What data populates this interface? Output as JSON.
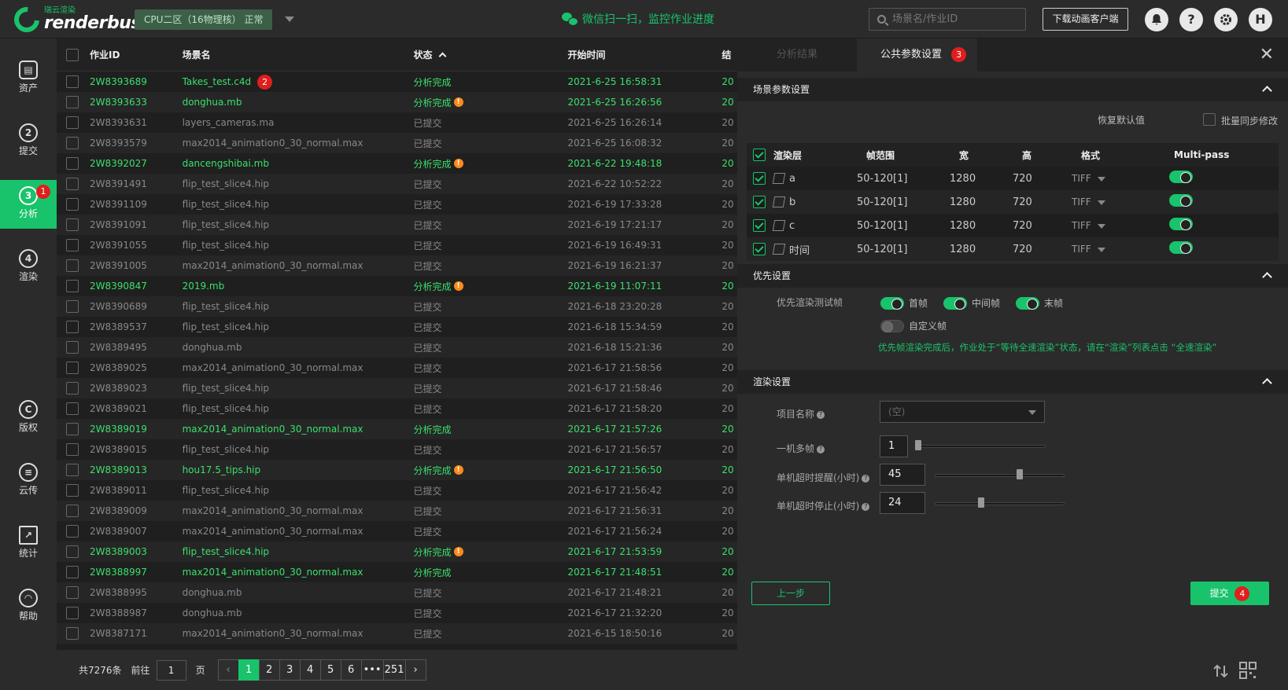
{
  "header": {
    "logo_cn": "瑞云渲染",
    "logo_en": "renderbus",
    "cpu_select": "CPU二区（16物理核）  正常",
    "wechat_text": "微信扫一扫，监控作业进度",
    "search_placeholder": "场景名/作业ID",
    "download_button": "下载动画客户端",
    "help_icon": "?",
    "avatar": "H"
  },
  "sidebar": {
    "items": [
      {
        "label": "资产",
        "icon": "asset-icon",
        "glyph": "▤"
      },
      {
        "label": "提交",
        "icon": "submit-icon",
        "glyph": "2"
      },
      {
        "label": "分析",
        "icon": "analyze-icon",
        "glyph": "3",
        "badge": "1",
        "active": true
      },
      {
        "label": "渲染",
        "icon": "render-icon",
        "glyph": "4"
      },
      {
        "label": "版权",
        "icon": "copyright-icon",
        "glyph": "C"
      },
      {
        "label": "云传",
        "icon": "cloud-transfer-icon",
        "glyph": "≡"
      },
      {
        "label": "统计",
        "icon": "stats-icon",
        "glyph": "↗"
      },
      {
        "label": "帮助",
        "icon": "help-icon",
        "glyph": "◠"
      }
    ]
  },
  "table": {
    "columns": [
      "作业ID",
      "场景名",
      "状态",
      "开始时间",
      "结"
    ],
    "rows": [
      {
        "id": "2W8393689",
        "name": "Takes_test.c4d",
        "status": "分析完成",
        "time": "2021-6-25 16:58:31",
        "more": "20",
        "green": true,
        "warn": false,
        "badge": "2"
      },
      {
        "id": "2W8393633",
        "name": "donghua.mb",
        "status": "分析完成",
        "time": "2021-6-25 16:26:56",
        "more": "20",
        "green": true,
        "warn": true
      },
      {
        "id": "2W8393631",
        "name": "layers_cameras.ma",
        "status": "已提交",
        "time": "2021-6-25 16:26:14",
        "more": "20",
        "green": false
      },
      {
        "id": "2W8393579",
        "name": "max2014_animation0_30_normal.max",
        "status": "已提交",
        "time": "2021-6-25 16:08:32",
        "more": "20",
        "green": false
      },
      {
        "id": "2W8392027",
        "name": "dancengshibai.mb",
        "status": "分析完成",
        "time": "2021-6-22 19:48:18",
        "more": "20",
        "green": true,
        "warn": true
      },
      {
        "id": "2W8391491",
        "name": "flip_test_slice4.hip",
        "status": "已提交",
        "time": "2021-6-22 10:52:22",
        "more": "20",
        "green": false
      },
      {
        "id": "2W8391109",
        "name": "flip_test_slice4.hip",
        "status": "已提交",
        "time": "2021-6-19 17:33:28",
        "more": "20",
        "green": false
      },
      {
        "id": "2W8391091",
        "name": "flip_test_slice4.hip",
        "status": "已提交",
        "time": "2021-6-19 17:21:17",
        "more": "20",
        "green": false
      },
      {
        "id": "2W8391055",
        "name": "flip_test_slice4.hip",
        "status": "已提交",
        "time": "2021-6-19 16:49:31",
        "more": "20",
        "green": false
      },
      {
        "id": "2W8391005",
        "name": "max2014_animation0_30_normal.max",
        "status": "已提交",
        "time": "2021-6-19 16:21:37",
        "more": "20",
        "green": false
      },
      {
        "id": "2W8390847",
        "name": "2019.mb",
        "status": "分析完成",
        "time": "2021-6-19 11:07:11",
        "more": "20",
        "green": true,
        "warn": true
      },
      {
        "id": "2W8390689",
        "name": "flip_test_slice4.hip",
        "status": "已提交",
        "time": "2021-6-18 23:20:28",
        "more": "20",
        "green": false
      },
      {
        "id": "2W8389537",
        "name": "flip_test_slice4.hip",
        "status": "已提交",
        "time": "2021-6-18 15:34:59",
        "more": "20",
        "green": false
      },
      {
        "id": "2W8389495",
        "name": "donghua.mb",
        "status": "已提交",
        "time": "2021-6-18 15:21:36",
        "more": "20",
        "green": false
      },
      {
        "id": "2W8389025",
        "name": "max2014_animation0_30_normal.max",
        "status": "已提交",
        "time": "2021-6-17 21:58:56",
        "more": "20",
        "green": false
      },
      {
        "id": "2W8389023",
        "name": "flip_test_slice4.hip",
        "status": "已提交",
        "time": "2021-6-17 21:58:46",
        "more": "20",
        "green": false
      },
      {
        "id": "2W8389021",
        "name": "flip_test_slice4.hip",
        "status": "已提交",
        "time": "2021-6-17 21:58:20",
        "more": "20",
        "green": false
      },
      {
        "id": "2W8389019",
        "name": "max2014_animation0_30_normal.max",
        "status": "分析完成",
        "time": "2021-6-17 21:57:26",
        "more": "20",
        "green": true,
        "warn": false
      },
      {
        "id": "2W8389015",
        "name": "flip_test_slice4.hip",
        "status": "已提交",
        "time": "2021-6-17 21:56:57",
        "more": "20",
        "green": false
      },
      {
        "id": "2W8389013",
        "name": "hou17.5_tips.hip",
        "status": "分析完成",
        "time": "2021-6-17 21:56:50",
        "more": "20",
        "green": true,
        "warn": true
      },
      {
        "id": "2W8389011",
        "name": "flip_test_slice4.hip",
        "status": "已提交",
        "time": "2021-6-17 21:56:42",
        "more": "20",
        "green": false
      },
      {
        "id": "2W8389009",
        "name": "max2014_animation0_30_normal.max",
        "status": "已提交",
        "time": "2021-6-17 21:56:31",
        "more": "20",
        "green": false
      },
      {
        "id": "2W8389007",
        "name": "max2014_animation0_30_normal.max",
        "status": "已提交",
        "time": "2021-6-17 21:56:24",
        "more": "20",
        "green": false
      },
      {
        "id": "2W8389003",
        "name": "flip_test_slice4.hip",
        "status": "分析完成",
        "time": "2021-6-17 21:53:59",
        "more": "20",
        "green": true,
        "warn": true
      },
      {
        "id": "2W8388997",
        "name": "max2014_animation0_30_normal.max",
        "status": "分析完成",
        "time": "2021-6-17 21:48:51",
        "more": "20",
        "green": true,
        "warn": false
      },
      {
        "id": "2W8388995",
        "name": "donghua.mb",
        "status": "已提交",
        "time": "2021-6-17 21:48:21",
        "more": "20",
        "green": false
      },
      {
        "id": "2W8388987",
        "name": "donghua.mb",
        "status": "已提交",
        "time": "2021-6-17 21:32:20",
        "more": "20",
        "green": false
      },
      {
        "id": "2W8387171",
        "name": "max2014_animation0_30_normal.max",
        "status": "已提交",
        "time": "2021-6-15 18:50:16",
        "more": "20",
        "green": false
      }
    ]
  },
  "pager": {
    "total": "共7276条",
    "goto": "前往",
    "page_value": "1",
    "page_unit": "页",
    "pages": [
      "1",
      "2",
      "3",
      "4",
      "5",
      "6",
      "•••",
      "251"
    ],
    "prev": "‹",
    "next": "›"
  },
  "panel": {
    "tab_analysis": "分析结果",
    "tab_params": "公共参数设置",
    "tab_badge": "3",
    "close": "✕",
    "scene_section": "场景参数设置",
    "restore_default": "恢复默认值",
    "batch_sync": "批量同步修改",
    "layer_columns": [
      "渲染层",
      "帧范围",
      "宽",
      "高",
      "格式",
      "Multi-pass"
    ],
    "layers": [
      {
        "name": "a",
        "range": "50-120[1]",
        "w": "1280",
        "h": "720",
        "fmt": "TIFF"
      },
      {
        "name": "b",
        "range": "50-120[1]",
        "w": "1280",
        "h": "720",
        "fmt": "TIFF"
      },
      {
        "name": "c",
        "range": "50-120[1]",
        "w": "1280",
        "h": "720",
        "fmt": "TIFF"
      },
      {
        "name": "时间",
        "range": "50-120[1]",
        "w": "1280",
        "h": "720",
        "fmt": "TIFF"
      }
    ],
    "priority_section": "优先设置",
    "priority_label": "优先渲染测试帧",
    "prio_first": "首帧",
    "prio_middle": "中间帧",
    "prio_last": "末帧",
    "prio_custom": "自定义帧",
    "prio_note": "优先帧渲染完成后，作业处于“等待全速渲染”状态，请在“渲染”列表点击 “全速渲染”",
    "render_section": "渲染设置",
    "project_label": "项目名称",
    "project_value": "(空)",
    "multi_frame_label": "一机多帧",
    "multi_frame_value": "1",
    "timeout_warn_label": "单机超时提醒(小时)",
    "timeout_warn_value": "45",
    "timeout_stop_label": "单机超时停止(小时)",
    "timeout_stop_value": "24",
    "prev_button": "上一步",
    "submit_button": "提交",
    "submit_badge": "4"
  },
  "colors": {
    "accent": "#19c36b",
    "badge": "#e01e1e",
    "warn": "#ff8a1c"
  }
}
